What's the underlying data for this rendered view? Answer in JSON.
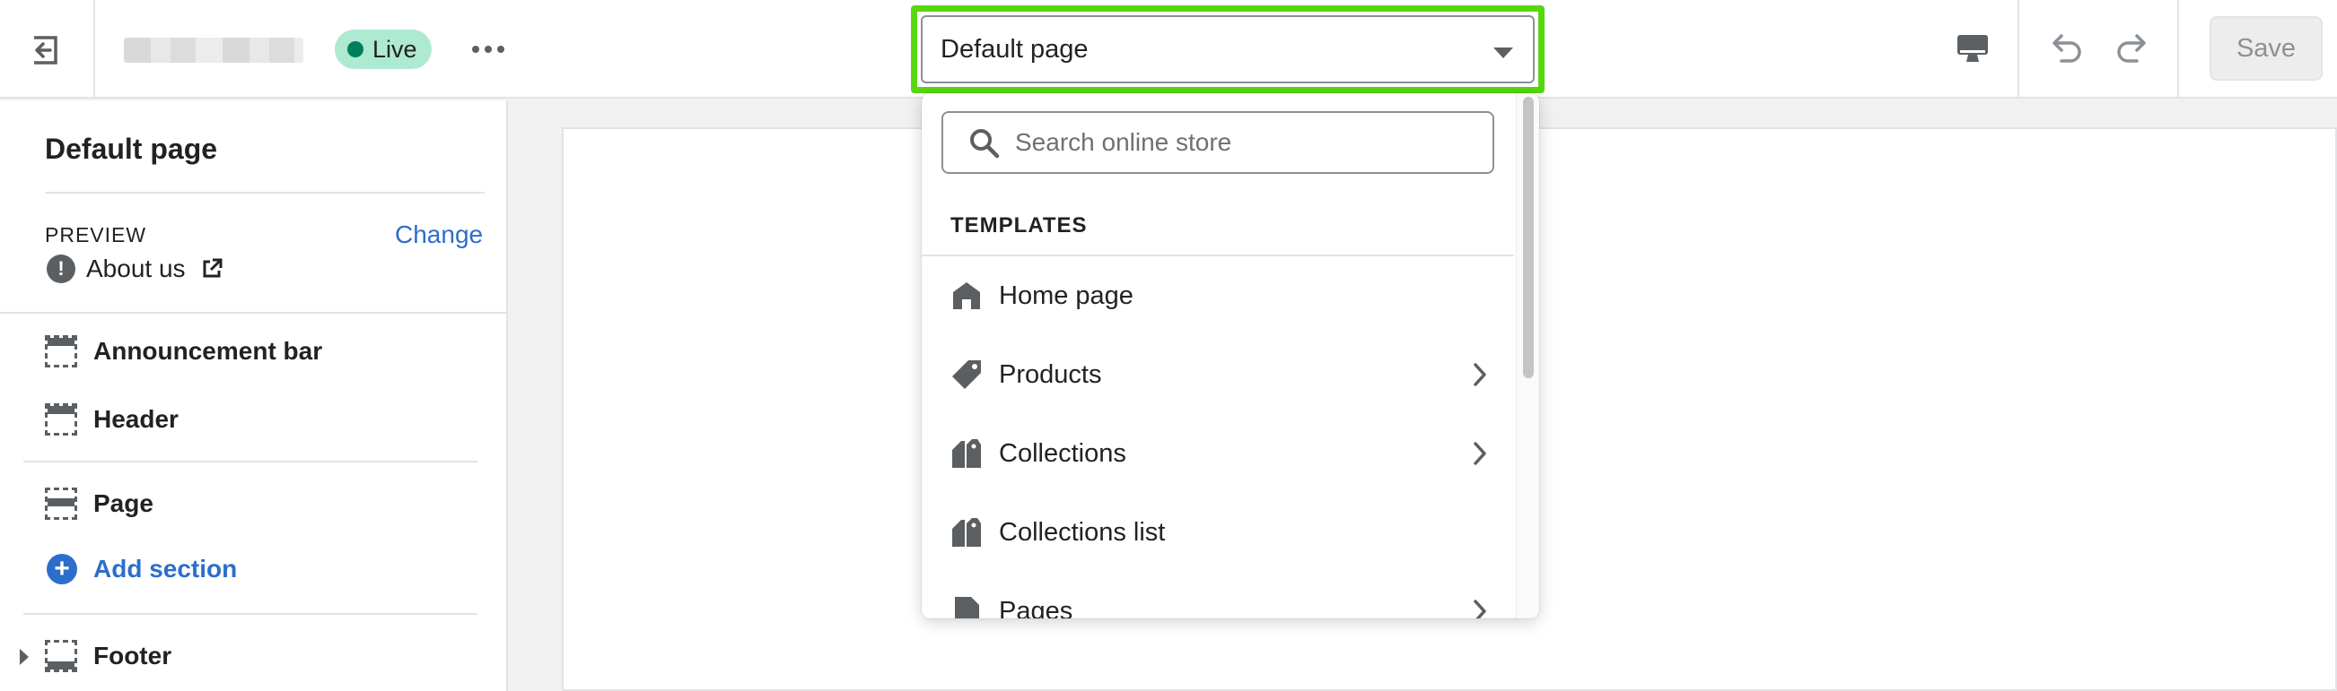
{
  "topbar": {
    "exit_icon": "exit-icon",
    "status_badge": "Live",
    "more_icon": "more-horizontal-icon",
    "template_select_value": "Default page",
    "device_icon": "desktop-icon",
    "undo_icon": "undo-icon",
    "redo_icon": "redo-icon",
    "save_label": "Save"
  },
  "sidebar": {
    "title": "Default page",
    "preview_label": "PREVIEW",
    "change_label": "Change",
    "preview_page": "About us",
    "sections": [
      {
        "label": "Announcement bar",
        "icon": "announcement-bar-icon"
      },
      {
        "label": "Header",
        "icon": "header-section-icon"
      },
      {
        "label": "Page",
        "icon": "page-section-icon"
      }
    ],
    "add_section_label": "Add section",
    "footer_label": "Footer"
  },
  "dropdown": {
    "search_placeholder": "Search online store",
    "heading": "TEMPLATES",
    "items": [
      {
        "label": "Home page",
        "icon": "home-icon",
        "has_submenu": false
      },
      {
        "label": "Products",
        "icon": "tag-icon",
        "has_submenu": true
      },
      {
        "label": "Collections",
        "icon": "collections-icon",
        "has_submenu": true
      },
      {
        "label": "Collections list",
        "icon": "collections-list-icon",
        "has_submenu": false
      },
      {
        "label": "Pages",
        "icon": "page-icon",
        "has_submenu": true
      }
    ]
  },
  "colors": {
    "accent_link": "#2c6ecb",
    "live_badge_bg": "#aee9d1",
    "highlight_border": "#57d70f"
  }
}
